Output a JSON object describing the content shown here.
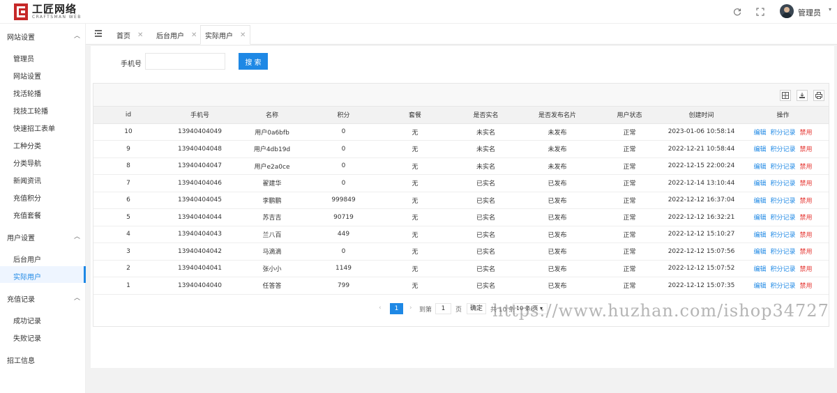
{
  "brand": {
    "title": "工匠网络",
    "subtitle": "CRAFTSMAN WEB"
  },
  "header": {
    "admin_name": "管理员"
  },
  "sidebar": {
    "groups": [
      {
        "label": "网站设置",
        "items": [
          "管理员",
          "网站设置",
          "找活轮播",
          "找技工轮播",
          "快速招工表单",
          "工种分类",
          "分类导航",
          "新闻资讯",
          "充值积分",
          "充值套餐"
        ]
      },
      {
        "label": "用户设置",
        "items": [
          "后台用户",
          "实际用户"
        ]
      },
      {
        "label": "充值记录",
        "items": [
          "成功记录",
          "失败记录"
        ]
      },
      {
        "label": "招工信息",
        "items": []
      }
    ],
    "active_item": "实际用户"
  },
  "tabs": [
    {
      "label": "首页"
    },
    {
      "label": "后台用户"
    },
    {
      "label": "实际用户",
      "active": true
    }
  ],
  "search": {
    "label": "手机号",
    "value": "",
    "button": "搜 索"
  },
  "table": {
    "headers": [
      "id",
      "手机号",
      "名称",
      "积分",
      "套餐",
      "是否实名",
      "是否发布名片",
      "用户状态",
      "创建时间",
      "操作"
    ],
    "rows": [
      [
        "10",
        "13940404049",
        "用户0a6bfb",
        "0",
        "无",
        "未实名",
        "未发布",
        "正常",
        "2023-01-06 10:58:14"
      ],
      [
        "9",
        "13940404048",
        "用户4db19d",
        "0",
        "无",
        "未实名",
        "未发布",
        "正常",
        "2022-12-21 10:58:44"
      ],
      [
        "8",
        "13940404047",
        "用户e2a0ce",
        "0",
        "无",
        "未实名",
        "未发布",
        "正常",
        "2022-12-15 22:00:24"
      ],
      [
        "7",
        "13940404046",
        "翟建华",
        "0",
        "无",
        "已实名",
        "已发布",
        "正常",
        "2022-12-14 13:10:44"
      ],
      [
        "6",
        "13940404045",
        "李鹏鹏",
        "999849",
        "无",
        "已实名",
        "已发布",
        "正常",
        "2022-12-12 16:37:04"
      ],
      [
        "5",
        "13940404044",
        "苏吉吉",
        "90719",
        "无",
        "已实名",
        "已发布",
        "正常",
        "2022-12-12 16:32:21"
      ],
      [
        "4",
        "13940404043",
        "兰八百",
        "449",
        "无",
        "已实名",
        "已发布",
        "正常",
        "2022-12-12 15:10:27"
      ],
      [
        "3",
        "13940404042",
        "马滴滴",
        "0",
        "无",
        "已实名",
        "已发布",
        "正常",
        "2022-12-12 15:07:56"
      ],
      [
        "2",
        "13940404041",
        "张小小",
        "1149",
        "无",
        "已实名",
        "已发布",
        "正常",
        "2022-12-12 15:07:52"
      ],
      [
        "1",
        "13940404040",
        "任答答",
        "799",
        "无",
        "已实名",
        "已发布",
        "正常",
        "2022-12-12 15:07:35"
      ]
    ],
    "actions": {
      "edit": "编辑",
      "points": "积分记录",
      "ban": "禁用"
    }
  },
  "pager": {
    "current_page": "1",
    "goto_label": "到第",
    "goto_value": "1",
    "page_unit": "页",
    "confirm": "确定",
    "total": "共 10 条",
    "page_size": "10 条/页"
  },
  "watermark": "https://www.huzhan.com/ishop34727",
  "colors": {
    "accent": "#1e88e5",
    "danger": "#e53935",
    "brand": "#c62828"
  }
}
